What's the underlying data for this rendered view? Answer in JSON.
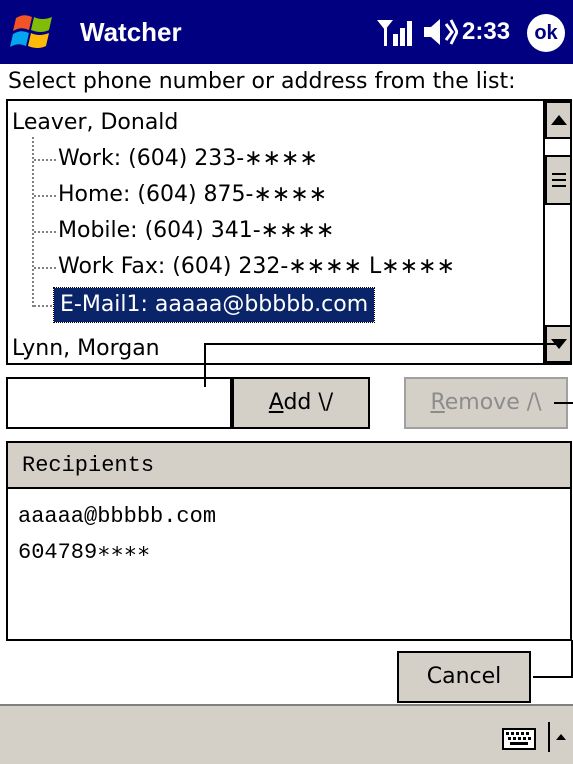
{
  "titlebar": {
    "app_title": "Watcher",
    "clock": "2:33",
    "ok_label": "ok",
    "start_icon": "windows-flag-icon",
    "signal_icon": "signal-strength-icon",
    "volume_icon": "speaker-volume-icon",
    "background_color": "#000080"
  },
  "instruction": "Select phone number or address from the list:",
  "contacts": [
    {
      "name": "Leaver, Donald",
      "entries": [
        {
          "label": "Work: (604) 233-∗∗∗∗",
          "selected": false
        },
        {
          "label": "Home: (604) 875-∗∗∗∗",
          "selected": false
        },
        {
          "label": "Mobile: (604) 341-∗∗∗∗",
          "selected": false
        },
        {
          "label": "Work Fax: (604) 232-∗∗∗∗ L∗∗∗∗",
          "selected": false
        },
        {
          "label": "E-Mail1: aaaaa@bbbbb.com",
          "selected": true
        }
      ]
    },
    {
      "name": "Lynn, Morgan",
      "entries": []
    }
  ],
  "address_input": {
    "value": "",
    "placeholder": ""
  },
  "buttons": {
    "add_accel": "A",
    "add_rest": "dd  \\/",
    "remove_accel": "R",
    "remove_rest": "emove  /\\",
    "cancel": "Cancel"
  },
  "recipients": {
    "header": "Recipients",
    "items": [
      "aaaaa@bbbbb.com",
      "604789∗∗∗∗"
    ]
  },
  "command_bar": {
    "keyboard_icon": "keyboard-icon",
    "sip_arrow_icon": "chevron-up-icon"
  },
  "colors": {
    "selection": "#0a246a",
    "button_face": "#d4d0c8",
    "disabled_text": "#8c8c8c"
  }
}
